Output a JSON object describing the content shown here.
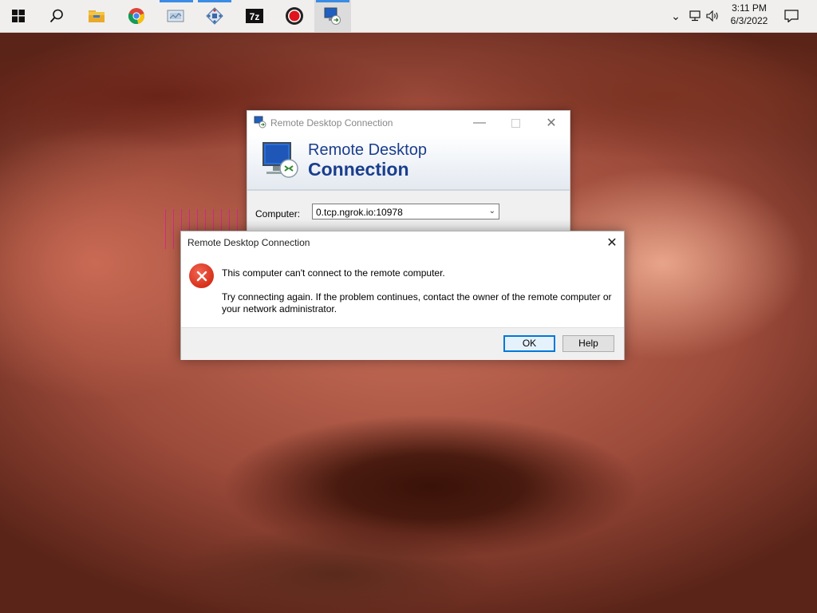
{
  "taskbar": {
    "pinned": [
      {
        "name": "start",
        "icon": "windows-logo-icon"
      },
      {
        "name": "search",
        "icon": "search-icon"
      },
      {
        "name": "file-explorer",
        "icon": "folder-icon"
      },
      {
        "name": "chrome",
        "icon": "chrome-icon"
      },
      {
        "name": "app-window",
        "icon": "window-app-icon"
      },
      {
        "name": "network-app",
        "icon": "network-app-icon"
      },
      {
        "name": "7zip",
        "icon": "7zip-icon",
        "label": "7z"
      },
      {
        "name": "recorder",
        "icon": "record-icon"
      },
      {
        "name": "remote-desktop",
        "icon": "remote-desktop-icon"
      }
    ],
    "tray": {
      "chevron_icon": "chevron-up-icon",
      "network_icon": "network-icon",
      "volume_icon": "volume-icon",
      "notification_icon": "notification-icon"
    },
    "clock": {
      "time": "3:11 PM",
      "date": "6/3/2022"
    }
  },
  "rdc_window": {
    "title": "Remote Desktop Connection",
    "banner_line1": "Remote Desktop",
    "banner_line2": "Connection",
    "computer_label": "Computer:",
    "computer_value": "0.tcp.ngrok.io:10978"
  },
  "error_dialog": {
    "title": "Remote Desktop Connection",
    "message": "This computer can't connect to the remote computer.",
    "detail": "Try connecting again. If the problem continues, contact the owner of the remote computer or your network administrator.",
    "ok_label": "OK",
    "help_label": "Help"
  },
  "colors": {
    "accent": "#0078d7",
    "banner_text": "#1a3e8e",
    "error_red": "#d7311c",
    "taskbar_active": "#3b8ce4"
  }
}
